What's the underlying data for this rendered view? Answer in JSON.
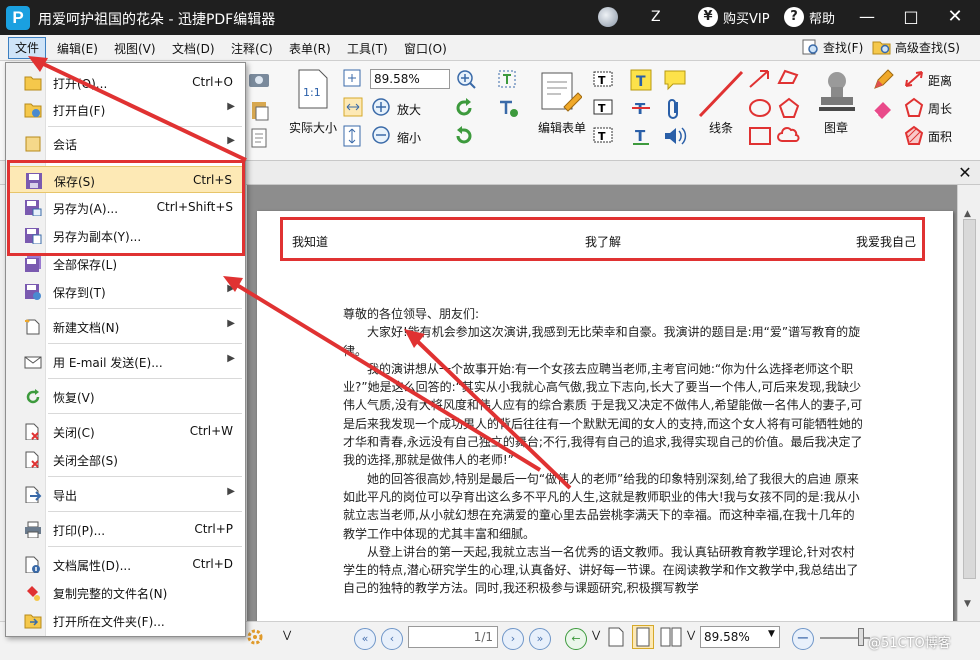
{
  "window": {
    "title": "用爱呵护祖国的花朵 - 迅捷PDF编辑器",
    "logo_letter": "P",
    "user_label": "Z",
    "vip_label": "购买VIP",
    "vip_icon": "¥",
    "help_label": "帮助",
    "help_icon": "?"
  },
  "menubar": {
    "items": [
      "文件",
      "编辑(E)",
      "视图(V)",
      "文档(D)",
      "注释(C)",
      "表单(R)",
      "工具(T)",
      "窗口(O)"
    ],
    "find_label": "查找(F)",
    "advanced_find_label": "高级查找(S)"
  },
  "toolbar": {
    "zoom_value": "89.58%",
    "actual_size_label": "实际大小",
    "actual_size_icon": "1:1",
    "zoom_in_label": "放大",
    "zoom_out_label": "缩小",
    "edit_form_label": "编辑表单",
    "line_label": "线条",
    "stamp_label": "图章",
    "distance_label": "距离",
    "perimeter_label": "周长",
    "area_label": "面积"
  },
  "file_menu": {
    "items": [
      {
        "label": "打开(O)...",
        "shortcut": "Ctrl+O",
        "submenu": false,
        "icon": "open-folder-icon"
      },
      {
        "label": "打开自(F)",
        "shortcut": "",
        "submenu": true,
        "icon": "open-from-icon"
      },
      {
        "label": "会话",
        "shortcut": "",
        "submenu": true,
        "icon": "session-icon"
      },
      {
        "label": "保存(S)",
        "shortcut": "Ctrl+S",
        "submenu": false,
        "icon": "save-icon",
        "highlighted": true
      },
      {
        "label": "另存为(A)...",
        "shortcut": "Ctrl+Shift+S",
        "submenu": false,
        "icon": "save-as-icon"
      },
      {
        "label": "另存为副本(Y)...",
        "shortcut": "",
        "submenu": false,
        "icon": "save-copy-icon"
      },
      {
        "label": "全部保存(L)",
        "shortcut": "",
        "submenu": false,
        "icon": "save-all-icon"
      },
      {
        "label": "保存到(T)",
        "shortcut": "",
        "submenu": true,
        "icon": "save-to-icon"
      },
      {
        "label": "新建文档(N)",
        "shortcut": "",
        "submenu": true,
        "icon": "new-document-icon"
      },
      {
        "label": "用 E-mail 发送(E)...",
        "shortcut": "",
        "submenu": true,
        "icon": "email-icon"
      },
      {
        "label": "恢复(V)",
        "shortcut": "",
        "submenu": false,
        "icon": "revert-icon"
      },
      {
        "label": "关闭(C)",
        "shortcut": "Ctrl+W",
        "submenu": false,
        "icon": "close-document-icon"
      },
      {
        "label": "关闭全部(S)",
        "shortcut": "",
        "submenu": false,
        "icon": "close-all-icon"
      },
      {
        "label": "导出",
        "shortcut": "",
        "submenu": true,
        "icon": "export-icon"
      },
      {
        "label": "打印(P)...",
        "shortcut": "Ctrl+P",
        "submenu": false,
        "icon": "print-icon"
      },
      {
        "label": "文档属性(D)...",
        "shortcut": "Ctrl+D",
        "submenu": false,
        "icon": "document-properties-icon"
      },
      {
        "label": "复制完整的文件名(N)",
        "shortcut": "",
        "submenu": false,
        "icon": "copy-filename-icon"
      },
      {
        "label": "打开所在文件夹(F)...",
        "shortcut": "",
        "submenu": false,
        "icon": "open-folder-location-icon"
      }
    ]
  },
  "document": {
    "header": {
      "left": "我知道",
      "center": "我了解",
      "right": "我爱我自己"
    },
    "greeting": "尊敬的各位领导、朋友们:",
    "paragraphs": [
      "大家好!能有机会参加这次演讲,我感到无比荣幸和自豪。我演讲的题目是:用“爱”谱写教育的旋律。",
      "我的演讲想从一个故事开始:有一个女孩去应聘当老师,主考官问她:“你为什么选择老师这个职业?”她是这么回答的:“其实从小我就心高气傲,我立下志向,长大了要当一个伟人,可后来发现,我缺少伟人气质,没有大将风度和伟人应有的综合素质 于是我又决定不做伟人,希望能做一名伟人的妻子,可是后来我发现一个成功男人的背后往往有一个默默无闻的女人的支持,而这个女人将有可能牺牲她的才华和青春,永远没有自己独立的舞台;不行,我得有自己的追求,我得实现自己的价值。最后我决定了我的选择,那就是做伟人的老师!”",
      "她的回答很高妙,特别是最后一句“做伟人的老师”给我的印象特别深刻,给了我很大的启迪 原来如此平凡的岗位可以孕育出这么多不平凡的人生,这就是教师职业的伟大!我与女孩不同的是:我从小就立志当老师,从小就幻想在充满爱的童心里去品尝桃李满天下的幸福。而这种幸福,在我十几年的教学工作中体现的尤其丰富和细腻。",
      "从登上讲台的第一天起,我就立志当一名优秀的语文教师。我认真钻研教育教学理论,针对农村学生的特点,潜心研究学生的心理,认真备好、讲好每一节课。在阅读教学和作文教学中,我总结出了自己的独特的教学方法。同时,我还积极参与课题研究,积极撰写教学"
    ]
  },
  "statusbar": {
    "page_value": "1/1",
    "zoom_value": "89.58%",
    "watermark": "@51CTO博客"
  }
}
